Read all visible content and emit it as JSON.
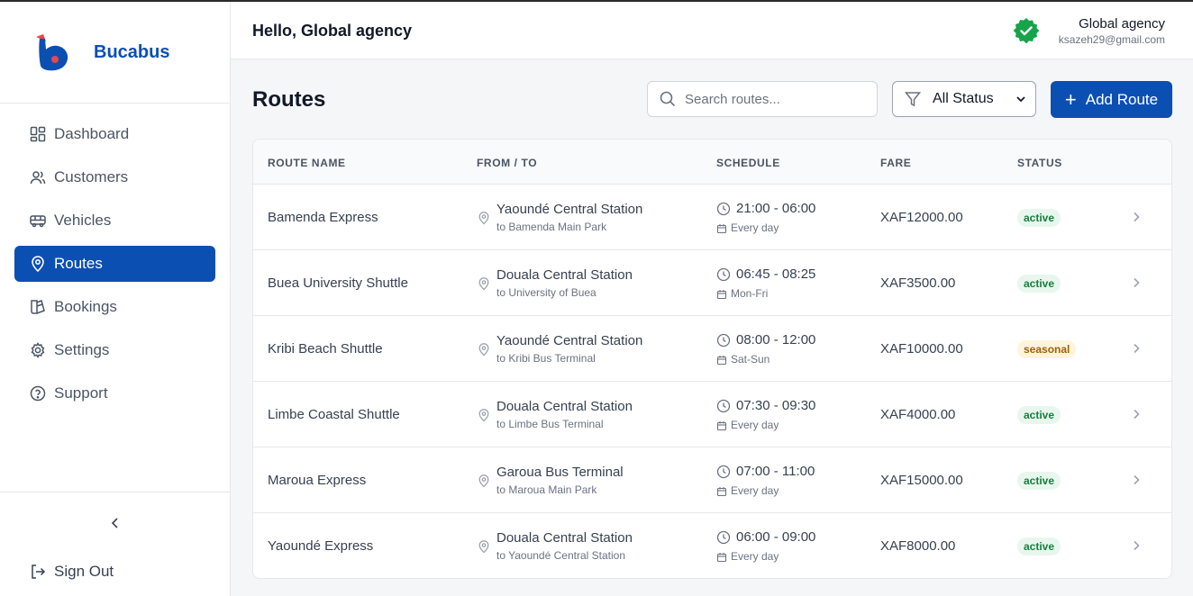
{
  "brand": {
    "name": "Bucabus"
  },
  "sidebar": {
    "items": [
      {
        "label": "Dashboard",
        "icon": "dashboard-icon"
      },
      {
        "label": "Customers",
        "icon": "users-icon"
      },
      {
        "label": "Vehicles",
        "icon": "bus-icon"
      },
      {
        "label": "Routes",
        "icon": "map-pin-icon",
        "active": true
      },
      {
        "label": "Bookings",
        "icon": "bookings-icon"
      },
      {
        "label": "Settings",
        "icon": "gear-icon"
      },
      {
        "label": "Support",
        "icon": "help-circle-icon"
      }
    ],
    "sign_out_label": "Sign Out"
  },
  "header": {
    "greeting": "Hello, Global agency",
    "user_name": "Global agency",
    "user_email": "ksazeh29@gmail.com"
  },
  "page": {
    "title": "Routes",
    "search_placeholder": "Search routes...",
    "filter_value": "All Status",
    "add_label": "Add Route"
  },
  "table": {
    "headers": {
      "route_name": "ROUTE NAME",
      "from_to": "FROM / TO",
      "schedule": "SCHEDULE",
      "fare": "FARE",
      "status": "STATUS"
    },
    "rows": [
      {
        "name": "Bamenda Express",
        "from": "Yaoundé Central Station",
        "to": "to Bamenda Main Park",
        "time": "21:00 - 06:00",
        "days": "Every day",
        "fare": "XAF12000.00",
        "status": "active"
      },
      {
        "name": "Buea University Shuttle",
        "from": "Douala Central Station",
        "to": "to University of Buea",
        "time": "06:45 - 08:25",
        "days": "Mon-Fri",
        "fare": "XAF3500.00",
        "status": "active"
      },
      {
        "name": "Kribi Beach Shuttle",
        "from": "Yaoundé Central Station",
        "to": "to Kribi Bus Terminal",
        "time": "08:00 - 12:00",
        "days": "Sat-Sun",
        "fare": "XAF10000.00",
        "status": "seasonal"
      },
      {
        "name": "Limbe Coastal Shuttle",
        "from": "Douala Central Station",
        "to": "to Limbe Bus Terminal",
        "time": "07:30 - 09:30",
        "days": "Every day",
        "fare": "XAF4000.00",
        "status": "active"
      },
      {
        "name": "Maroua Express",
        "from": "Garoua Bus Terminal",
        "to": "to Maroua Main Park",
        "time": "07:00 - 11:00",
        "days": "Every day",
        "fare": "XAF15000.00",
        "status": "active"
      },
      {
        "name": "Yaoundé Express",
        "from": "Douala Central Station",
        "to": "to Yaoundé Central Station",
        "time": "06:00 - 09:00",
        "days": "Every day",
        "fare": "XAF8000.00",
        "status": "active"
      }
    ]
  },
  "colors": {
    "primary": "#0b4fb3",
    "success": "#16a34a",
    "active_badge_bg": "#e8f7ee",
    "seasonal_badge_bg": "#fdf4dc"
  }
}
